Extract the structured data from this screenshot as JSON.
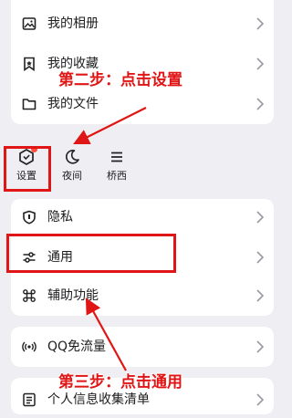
{
  "menu_top": {
    "items": [
      {
        "label": "我的相册",
        "icon": "photo-album-icon"
      },
      {
        "label": "我的收藏",
        "icon": "bookmark-icon"
      },
      {
        "label": "我的文件",
        "icon": "folder-icon"
      }
    ]
  },
  "tab_bar": {
    "items": [
      {
        "label": "设置",
        "icon": "settings-hexagon-icon",
        "badge": true
      },
      {
        "label": "夜间",
        "icon": "moon-icon"
      },
      {
        "label": "桥西",
        "icon": "menu-lines-icon"
      }
    ]
  },
  "settings_list": {
    "items": [
      {
        "label": "隐私",
        "icon": "shield-icon"
      },
      {
        "label": "通用",
        "icon": "sliders-icon"
      },
      {
        "label": "辅助功能",
        "icon": "command-icon"
      }
    ]
  },
  "extra": {
    "qq_free_data": {
      "label": "QQ免流量",
      "icon": "signal-icon"
    },
    "personal_info": {
      "label": "个人信息收集清单",
      "icon": "list-document-icon"
    }
  },
  "annotations": {
    "step2": "第二步：点击设置",
    "step3": "第三步：点击通用"
  },
  "colors": {
    "annotation_red": "#e01616",
    "background": "#efeff3",
    "card": "#ffffff",
    "badge": "#ff4d3a"
  }
}
